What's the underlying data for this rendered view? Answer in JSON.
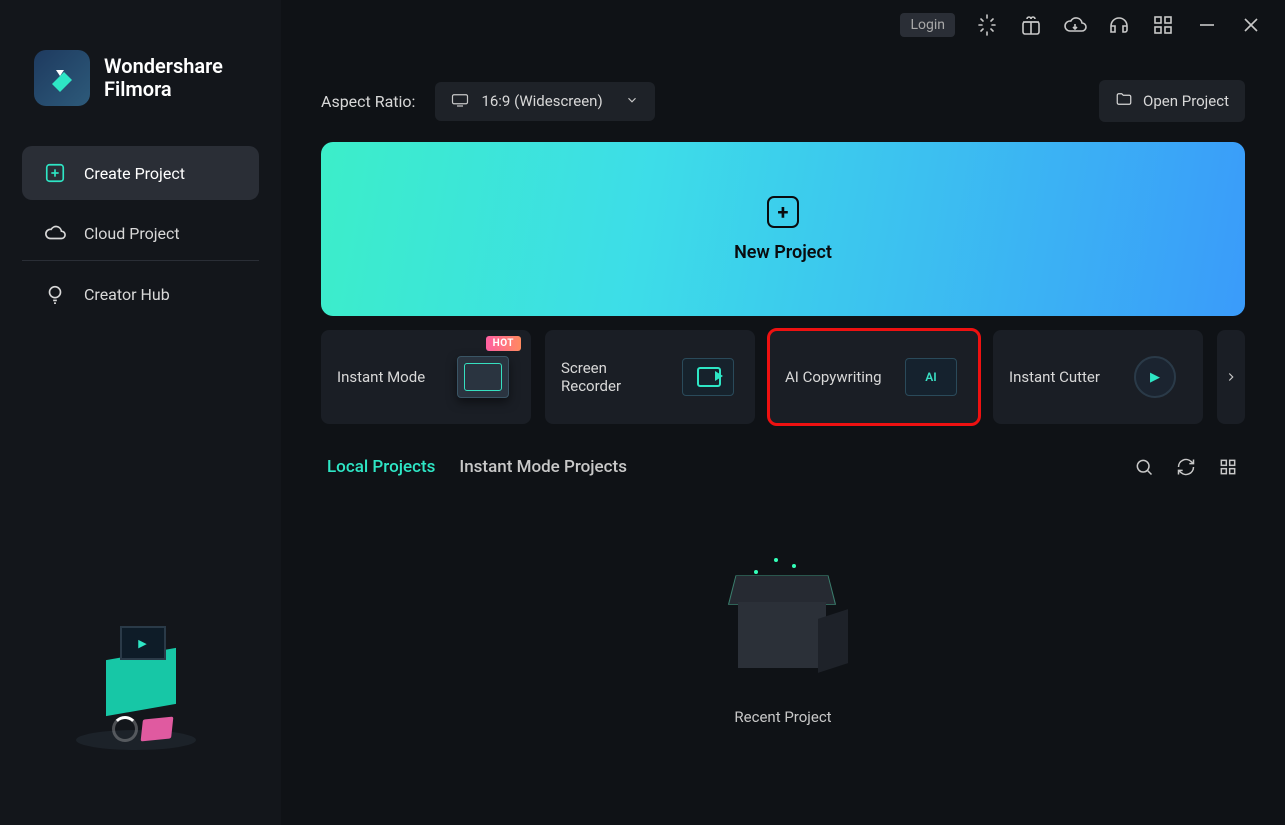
{
  "app": {
    "brand_line1": "Wondershare",
    "brand_line2": "Filmora"
  },
  "sidebar": {
    "items": [
      {
        "label": "Create Project"
      },
      {
        "label": "Cloud Project"
      },
      {
        "label": "Creator Hub"
      }
    ]
  },
  "titlebar": {
    "login_label": "Login"
  },
  "toprow": {
    "aspect_label": "Aspect Ratio:",
    "aspect_value": "16:9 (Widescreen)",
    "open_project_label": "Open Project"
  },
  "new_project": {
    "label": "New Project"
  },
  "tiles": [
    {
      "label": "Instant Mode",
      "badge": "HOT"
    },
    {
      "label": "Screen Recorder"
    },
    {
      "label": "AI Copywriting"
    },
    {
      "label": "Instant Cutter"
    }
  ],
  "tabs": {
    "local": "Local Projects",
    "instant": "Instant Mode Projects"
  },
  "recent": {
    "label": "Recent Project"
  },
  "ai_art_label": "AI"
}
